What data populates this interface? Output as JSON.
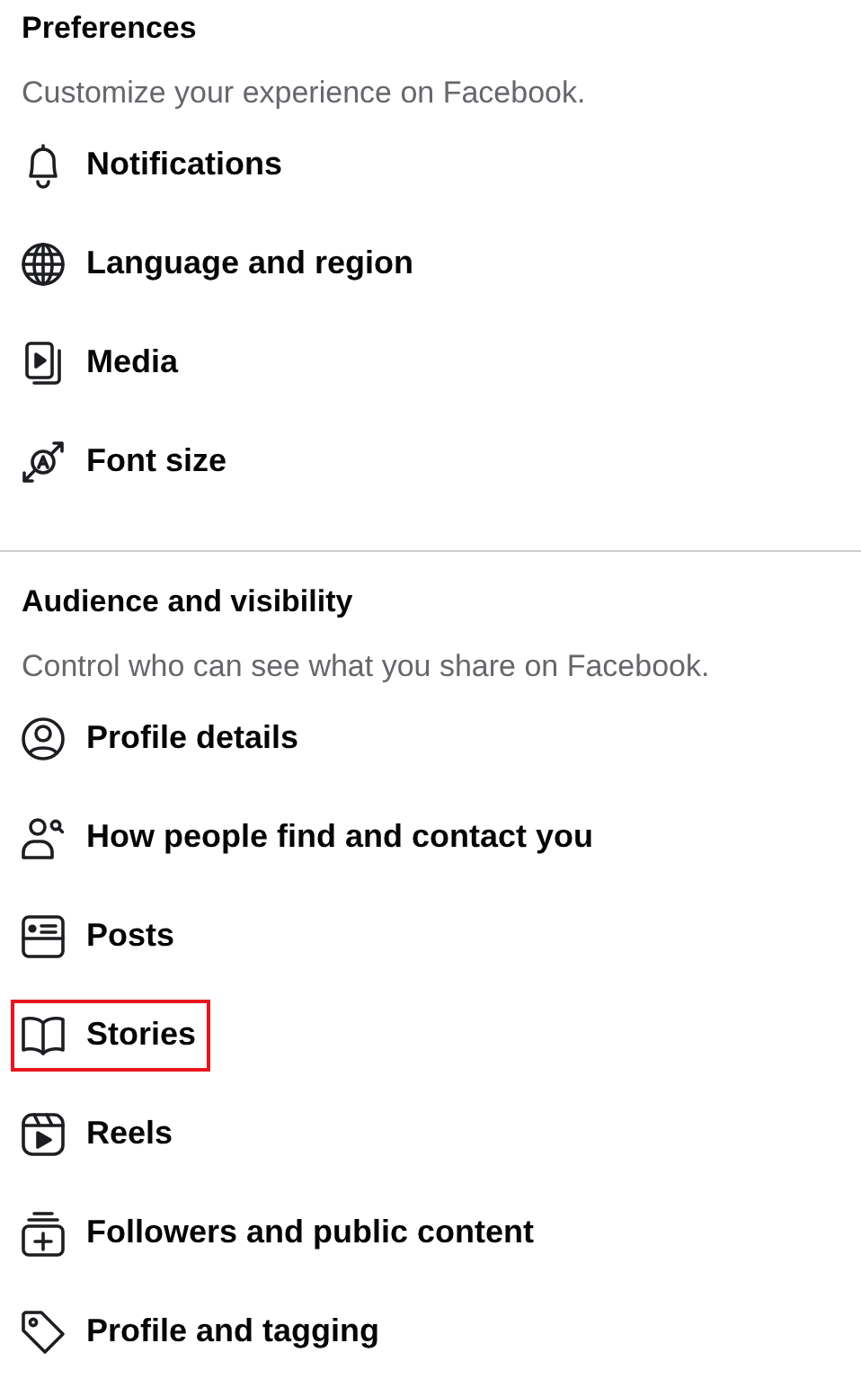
{
  "sections": [
    {
      "title": "Preferences",
      "subtitle": "Customize your experience on Facebook.",
      "items": [
        {
          "label": "Notifications",
          "highlighted": false
        },
        {
          "label": "Language and region",
          "highlighted": false
        },
        {
          "label": "Media",
          "highlighted": false
        },
        {
          "label": "Font size",
          "highlighted": false
        }
      ]
    },
    {
      "title": "Audience and visibility",
      "subtitle": "Control who can see what you share on Facebook.",
      "items": [
        {
          "label": "Profile details",
          "highlighted": false
        },
        {
          "label": "How people find and contact you",
          "highlighted": false
        },
        {
          "label": "Posts",
          "highlighted": false
        },
        {
          "label": "Stories",
          "highlighted": true
        },
        {
          "label": "Reels",
          "highlighted": false
        },
        {
          "label": "Followers and public content",
          "highlighted": false
        },
        {
          "label": "Profile and tagging",
          "highlighted": false
        }
      ]
    }
  ]
}
